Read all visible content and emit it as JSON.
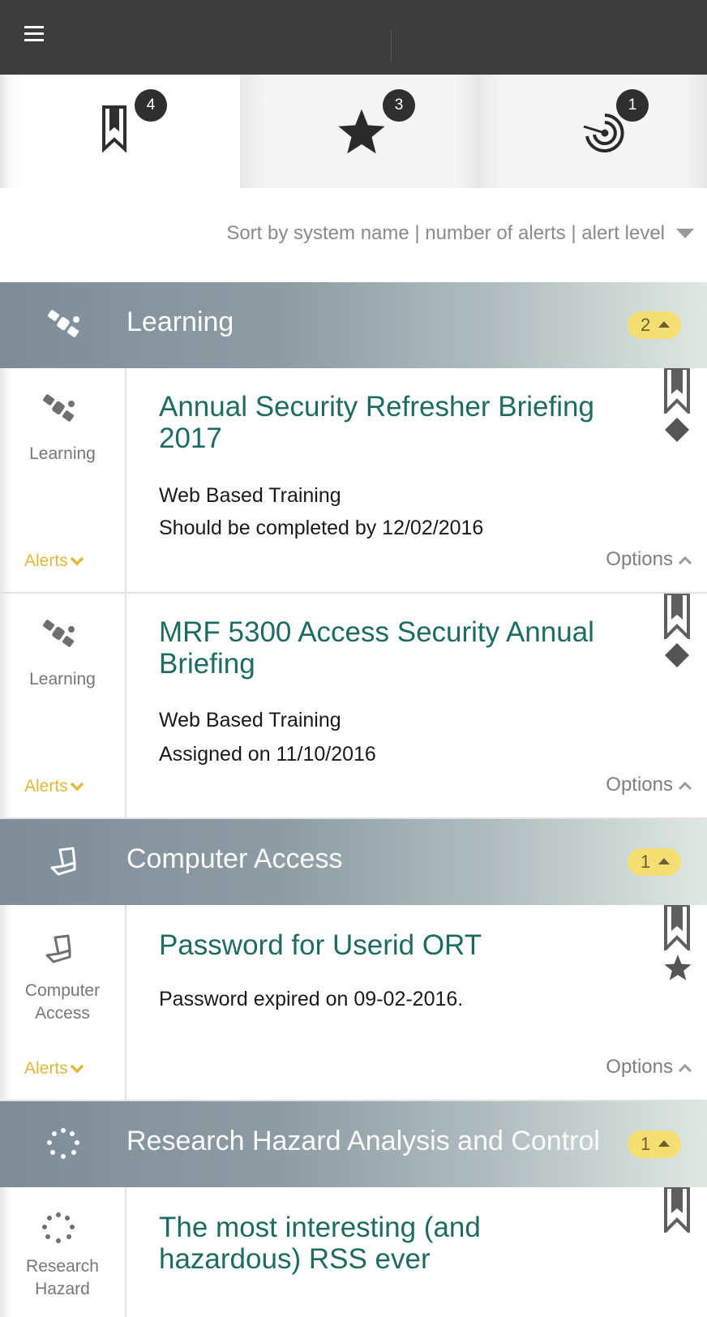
{
  "tabs": [
    {
      "icon": "bookmark-icon",
      "count": "4"
    },
    {
      "icon": "star-icon",
      "count": "3"
    },
    {
      "icon": "radar-icon",
      "count": "1"
    }
  ],
  "sort": {
    "label": "Sort by system name | number of alerts | alert level"
  },
  "sections": [
    {
      "title": "Learning",
      "icon": "satellite-icon",
      "count": "2",
      "cards": [
        {
          "system": "Learning",
          "title": "Annual Security Refresher Briefing 2017",
          "line1": "Web Based Training",
          "line2": "Should be completed by 12/02/2016",
          "alerts": "Alerts",
          "options": "Options",
          "flags": [
            "bookmark-icon",
            "diamond-icon"
          ]
        },
        {
          "system": "Learning",
          "title": "MRF 5300 Access Security Annual Briefing",
          "line1": "Web Based Training",
          "line2": "Assigned on 11/10/2016",
          "alerts": "Alerts",
          "options": "Options",
          "flags": [
            "bookmark-icon",
            "diamond-icon"
          ]
        }
      ]
    },
    {
      "title": "Computer Access",
      "icon": "laptop-icon",
      "count": "1",
      "cards": [
        {
          "system_line1": "Computer",
          "system_line2": "Access",
          "title": "Password for Userid ORT",
          "line1": "Password expired on 09-02-2016.",
          "alerts": "Alerts",
          "options": "Options",
          "flags": [
            "bookmark-icon",
            "star-icon"
          ]
        }
      ]
    },
    {
      "title": "Research Hazard Analysis and Control",
      "icon": "dots-ring-icon",
      "count": "1",
      "cards": [
        {
          "system_line1": "Research",
          "system_line2": "Hazard",
          "title": "The most interesting (and hazardous) RSS ever",
          "flags": [
            "bookmark-icon"
          ]
        }
      ]
    }
  ],
  "colors": {
    "topbar": "#3d3d3d",
    "title_teal": "#1e6b62",
    "alerts_gold": "#e0b93a",
    "badge_yellow": "#f5df73"
  }
}
